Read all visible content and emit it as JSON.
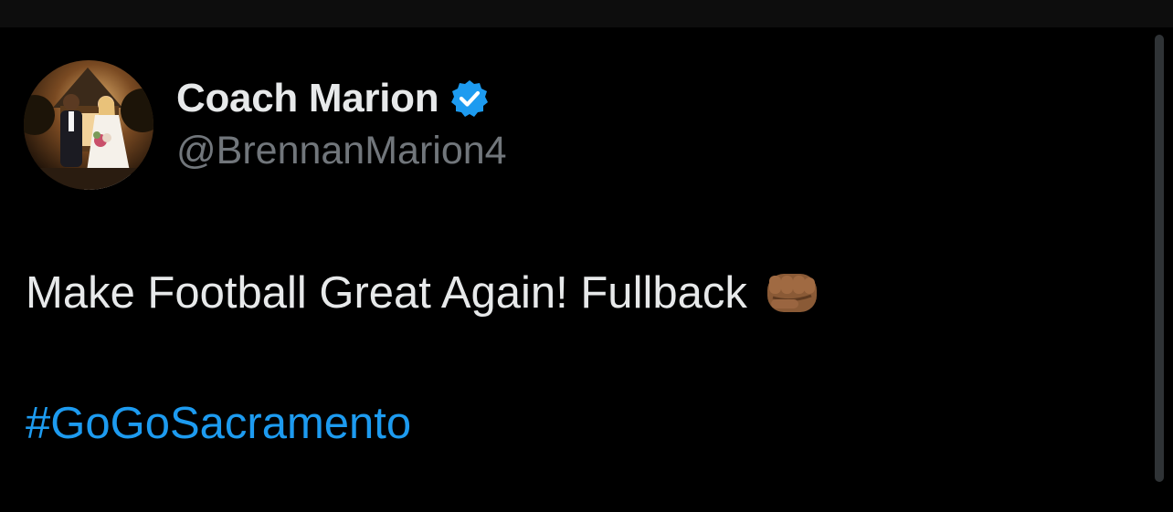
{
  "post": {
    "author": {
      "display_name": "Coach Marion",
      "handle": "@BrennanMarion4",
      "verified": true,
      "avatar_description_icon": "profile-photo"
    },
    "text": "Make Football Great Again! Fullback",
    "emoji_icon": "oncoming-fist-icon",
    "hashtag": "#GoGoSacramento"
  },
  "colors": {
    "background": "#000000",
    "primary_text": "#e7e9ea",
    "secondary_text": "#71767b",
    "link": "#1d9bf0",
    "verified_badge": "#1d9bf0"
  }
}
